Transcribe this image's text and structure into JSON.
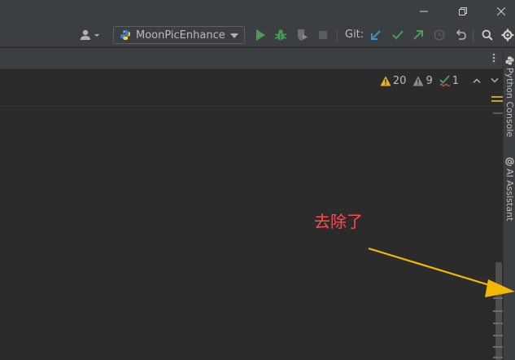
{
  "toolbar": {
    "run_configuration": "MoonPicEnhance",
    "git_label": "Git:"
  },
  "right_panel": {
    "tabs": [
      {
        "label": "Python Console",
        "icon": "python-icon"
      },
      {
        "label": "AI Assistant",
        "icon": "at-icon"
      }
    ]
  },
  "inspections": {
    "warnings": "20",
    "weak_warnings": "9",
    "typos": "1"
  },
  "annotation": {
    "text": "去除了"
  },
  "colors": {
    "accent_blue": "#3592c4",
    "run_green": "#499c54",
    "warning_yellow": "#e6b422",
    "annotation_red": "#ff4b4b",
    "annotation_arrow": "#f5b800"
  }
}
